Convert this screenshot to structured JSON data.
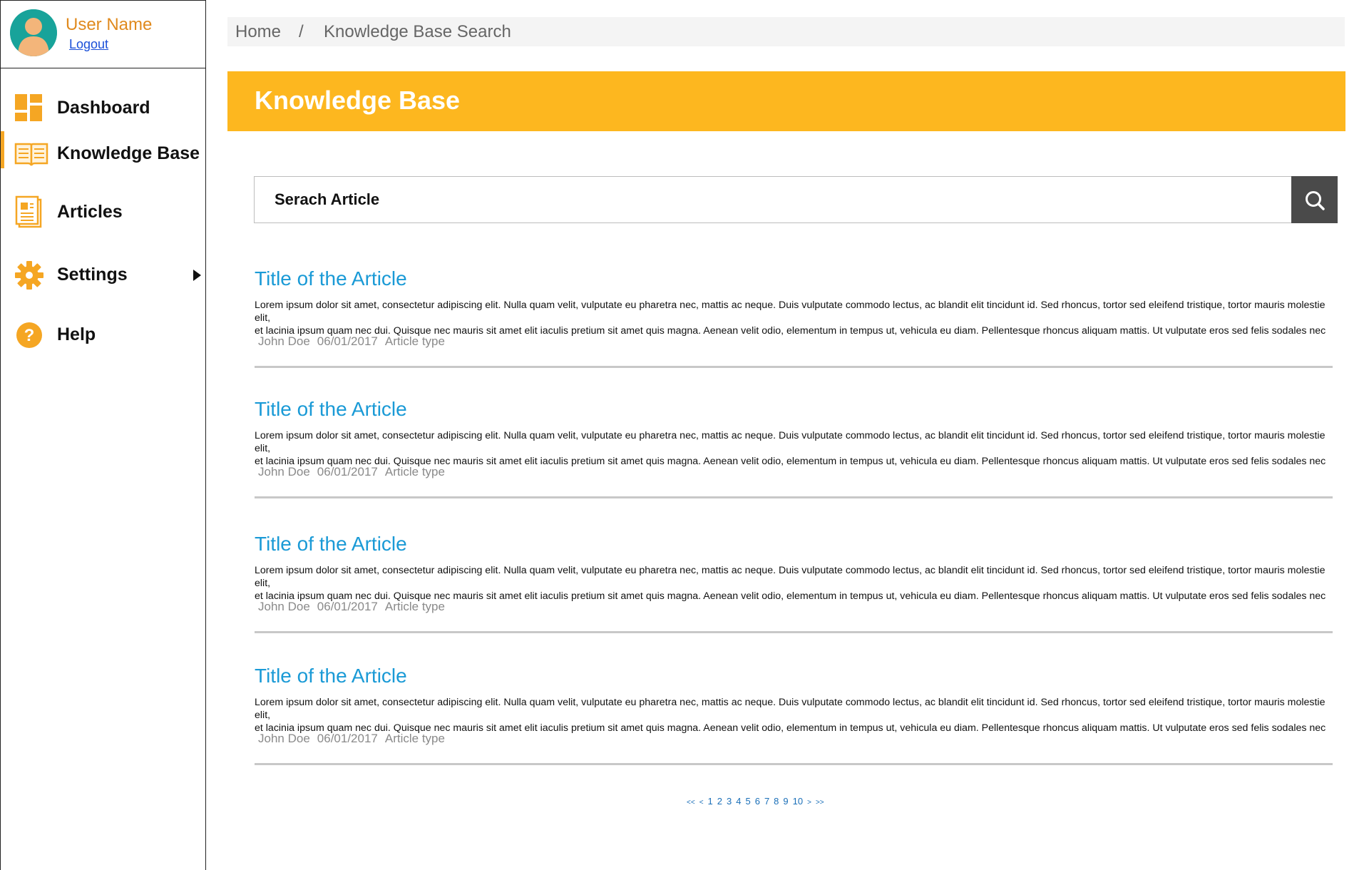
{
  "user": {
    "name": "User Name",
    "logout": "Logout"
  },
  "nav": {
    "items": [
      {
        "label": "Dashboard",
        "icon": "dashboard-icon"
      },
      {
        "label": "Knowledge Base",
        "icon": "book-icon",
        "active": true
      },
      {
        "label": "Articles",
        "icon": "document-icon"
      },
      {
        "label": "Settings",
        "icon": "gear-icon",
        "has_submenu": true
      },
      {
        "label": "Help",
        "icon": "help-icon"
      }
    ]
  },
  "breadcrumb": {
    "home": "Home",
    "separator": "/",
    "current": "Knowledge Base Search"
  },
  "banner": {
    "title": "Knowledge Base"
  },
  "search": {
    "placeholder": "Serach Article"
  },
  "articles": [
    {
      "title": "Title of the Article",
      "body_line1": "Lorem ipsum dolor sit amet, consectetur adipiscing elit. Nulla quam velit, vulputate eu pharetra nec, mattis ac neque. Duis vulputate commodo lectus, ac blandit elit tincidunt id. Sed rhoncus, tortor sed eleifend tristique, tortor mauris molestie elit,",
      "body_line2": "et lacinia ipsum quam nec dui. Quisque nec mauris sit amet elit iaculis pretium sit amet quis magna. Aenean velit odio, elementum in tempus ut, vehicula eu diam. Pellentesque rhoncus aliquam mattis. Ut vulputate eros sed felis sodales nec",
      "author": "John Doe",
      "date": "06/01/2017",
      "type": "Article type"
    },
    {
      "title": "Title of the Article",
      "body_line1": "Lorem ipsum dolor sit amet, consectetur adipiscing elit. Nulla quam velit, vulputate eu pharetra nec, mattis ac neque. Duis vulputate commodo lectus, ac blandit elit tincidunt id. Sed rhoncus, tortor sed eleifend tristique, tortor mauris molestie elit,",
      "body_line2": "et lacinia ipsum quam nec dui. Quisque nec mauris sit amet elit iaculis pretium sit amet quis magna. Aenean velit odio, elementum in tempus ut, vehicula eu diam. Pellentesque rhoncus aliquam mattis. Ut vulputate eros sed felis sodales nec",
      "author": "John Doe",
      "date": "06/01/2017",
      "type": "Article type"
    },
    {
      "title": "Title of the Article",
      "body_line1": "Lorem ipsum dolor sit amet, consectetur adipiscing elit. Nulla quam velit, vulputate eu pharetra nec, mattis ac neque. Duis vulputate commodo lectus, ac blandit elit tincidunt id. Sed rhoncus, tortor sed eleifend tristique, tortor mauris molestie elit,",
      "body_line2": "et lacinia ipsum quam nec dui. Quisque nec mauris sit amet elit iaculis pretium sit amet quis magna. Aenean velit odio, elementum in tempus ut, vehicula eu diam. Pellentesque rhoncus aliquam mattis. Ut vulputate eros sed felis sodales nec",
      "author": "John Doe",
      "date": "06/01/2017",
      "type": "Article type"
    },
    {
      "title": "Title of the Article",
      "body_line1": "Lorem ipsum dolor sit amet, consectetur adipiscing elit. Nulla quam velit, vulputate eu pharetra nec, mattis ac neque. Duis vulputate commodo lectus, ac blandit elit tincidunt id. Sed rhoncus, tortor sed eleifend tristique, tortor mauris molestie elit,",
      "body_line2": "et lacinia ipsum quam nec dui. Quisque nec mauris sit amet elit iaculis pretium sit amet quis magna. Aenean velit odio, elementum in tempus ut, vehicula eu diam. Pellentesque rhoncus aliquam mattis. Ut vulputate eros sed felis sodales nec",
      "author": "John Doe",
      "date": "06/01/2017",
      "type": "Article type"
    }
  ],
  "pagination": {
    "first": "<<",
    "prev": "<",
    "pages": [
      "1",
      "2",
      "3",
      "4",
      "5",
      "6",
      "7",
      "8",
      "9",
      "10"
    ],
    "next": ">",
    "last": ">>"
  },
  "colors": {
    "accent": "#fdb71f",
    "link": "#1a9ad6",
    "username": "#e08a1e",
    "search_button": "#4a4a4a"
  }
}
